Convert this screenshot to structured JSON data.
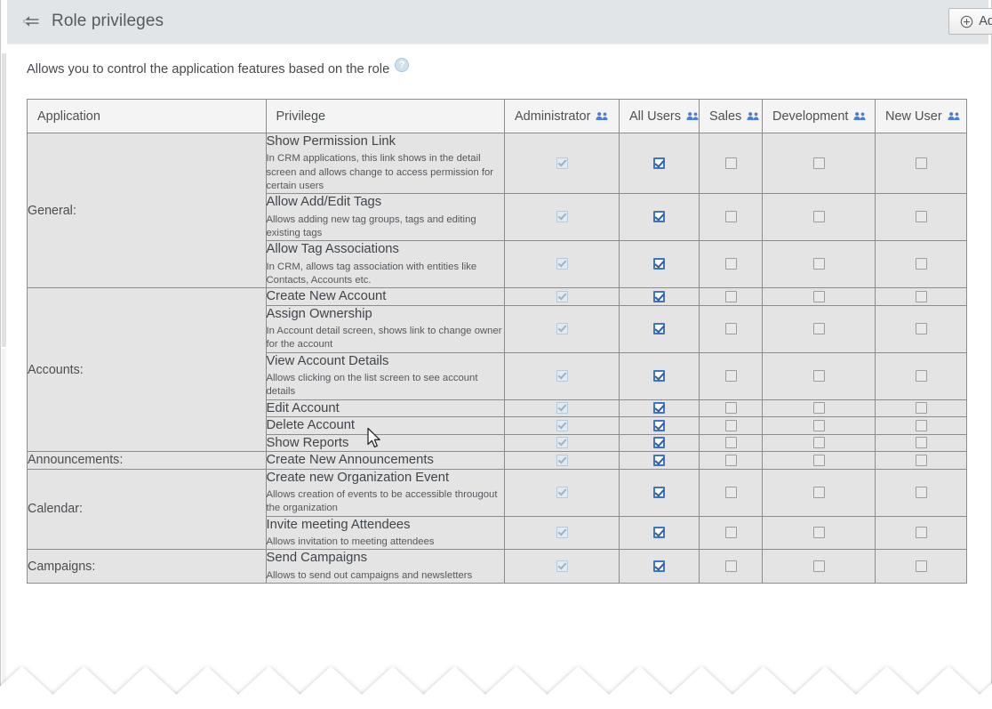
{
  "header": {
    "back_icon": "arrow-left-icon",
    "title": "Role privileges",
    "add_button_label": "Add",
    "add_button_icon": "plus-circle-icon"
  },
  "intro": {
    "text": "Allows you to control the application features based on the role",
    "help_icon": "question-mark-icon",
    "help_glyph": "?"
  },
  "colors": {
    "header_bar": "#e1e5e8",
    "table_header": "#f4f4f4",
    "row_background": "#e4e4e4",
    "grid_line": "#8c8c8c",
    "checkbox_checked": "#3c74c9",
    "people_icon": "#4a7ddb",
    "help_icon": "#cfe0ee",
    "text": "#45494d"
  },
  "table": {
    "columns": [
      {
        "key": "application",
        "label": "Application",
        "icon": null
      },
      {
        "key": "privilege",
        "label": "Privilege",
        "icon": null
      },
      {
        "key": "administrator",
        "label": "Administrator",
        "icon": "people-icon"
      },
      {
        "key": "all_users",
        "label": "All Users",
        "icon": "people-icon"
      },
      {
        "key": "sales",
        "label": "Sales",
        "icon": "people-icon"
      },
      {
        "key": "development",
        "label": "Development",
        "icon": "people-icon"
      },
      {
        "key": "new_user",
        "label": "New User",
        "icon": "people-icon"
      }
    ],
    "groups": [
      {
        "application": "General:",
        "rows": [
          {
            "name": "Show Permission Link",
            "description": "In CRM applications, this link shows in the detail screen and allows change to access permission for certain users",
            "administrator": "checked-disabled",
            "all_users": "checked",
            "sales": "unchecked",
            "development": "unchecked",
            "new_user": "unchecked"
          },
          {
            "name": "Allow Add/Edit Tags",
            "description": "Allows adding new tag groups, tags and editing existing tags",
            "administrator": "checked-disabled",
            "all_users": "checked",
            "sales": "unchecked",
            "development": "unchecked",
            "new_user": "unchecked"
          },
          {
            "name": "Allow Tag Associations",
            "description": "In CRM, allows tag association with entities like Contacts, Accounts etc.",
            "administrator": "checked-disabled",
            "all_users": "checked",
            "sales": "unchecked",
            "development": "unchecked",
            "new_user": "unchecked"
          }
        ]
      },
      {
        "application": "Accounts:",
        "rows": [
          {
            "name": "Create New Account",
            "description": "",
            "administrator": "checked-disabled",
            "all_users": "checked",
            "sales": "unchecked",
            "development": "unchecked",
            "new_user": "unchecked"
          },
          {
            "name": "Assign Ownership",
            "description": "In Account detail screen, shows link to change owner for the account",
            "administrator": "checked-disabled",
            "all_users": "checked",
            "sales": "unchecked",
            "development": "unchecked",
            "new_user": "unchecked"
          },
          {
            "name": "View Account Details",
            "description": "Allows clicking on the list screen to see account details",
            "administrator": "checked-disabled",
            "all_users": "checked",
            "sales": "unchecked",
            "development": "unchecked",
            "new_user": "unchecked"
          },
          {
            "name": "Edit Account",
            "description": "",
            "administrator": "checked-disabled",
            "all_users": "checked",
            "sales": "unchecked",
            "development": "unchecked",
            "new_user": "unchecked"
          },
          {
            "name": "Delete Account",
            "description": "",
            "administrator": "checked-disabled",
            "all_users": "checked",
            "sales": "unchecked",
            "development": "unchecked",
            "new_user": "unchecked"
          },
          {
            "name": "Show Reports",
            "description": "",
            "administrator": "checked-disabled",
            "all_users": "checked",
            "sales": "unchecked",
            "development": "unchecked",
            "new_user": "unchecked"
          }
        ]
      },
      {
        "application": "Announcements:",
        "rows": [
          {
            "name": "Create New Announcements",
            "description": "",
            "administrator": "checked-disabled",
            "all_users": "checked",
            "sales": "unchecked",
            "development": "unchecked",
            "new_user": "unchecked"
          }
        ]
      },
      {
        "application": "Calendar:",
        "rows": [
          {
            "name": "Create new Organization Event",
            "description": "Allows creation of events to be accessible througout the organization",
            "administrator": "checked-disabled",
            "all_users": "checked",
            "sales": "unchecked",
            "development": "unchecked",
            "new_user": "unchecked"
          },
          {
            "name": "Invite meeting Attendees",
            "description": "Allows invitation to meeting attendees",
            "administrator": "checked-disabled",
            "all_users": "checked",
            "sales": "unchecked",
            "development": "unchecked",
            "new_user": "unchecked"
          }
        ]
      },
      {
        "application": "Campaigns:",
        "rows": [
          {
            "name": "Send Campaigns",
            "description": "Allows to send out campaigns and newsletters",
            "administrator": "checked-disabled",
            "all_users": "checked",
            "sales": "unchecked",
            "development": "unchecked",
            "new_user": "unchecked"
          }
        ]
      }
    ]
  }
}
